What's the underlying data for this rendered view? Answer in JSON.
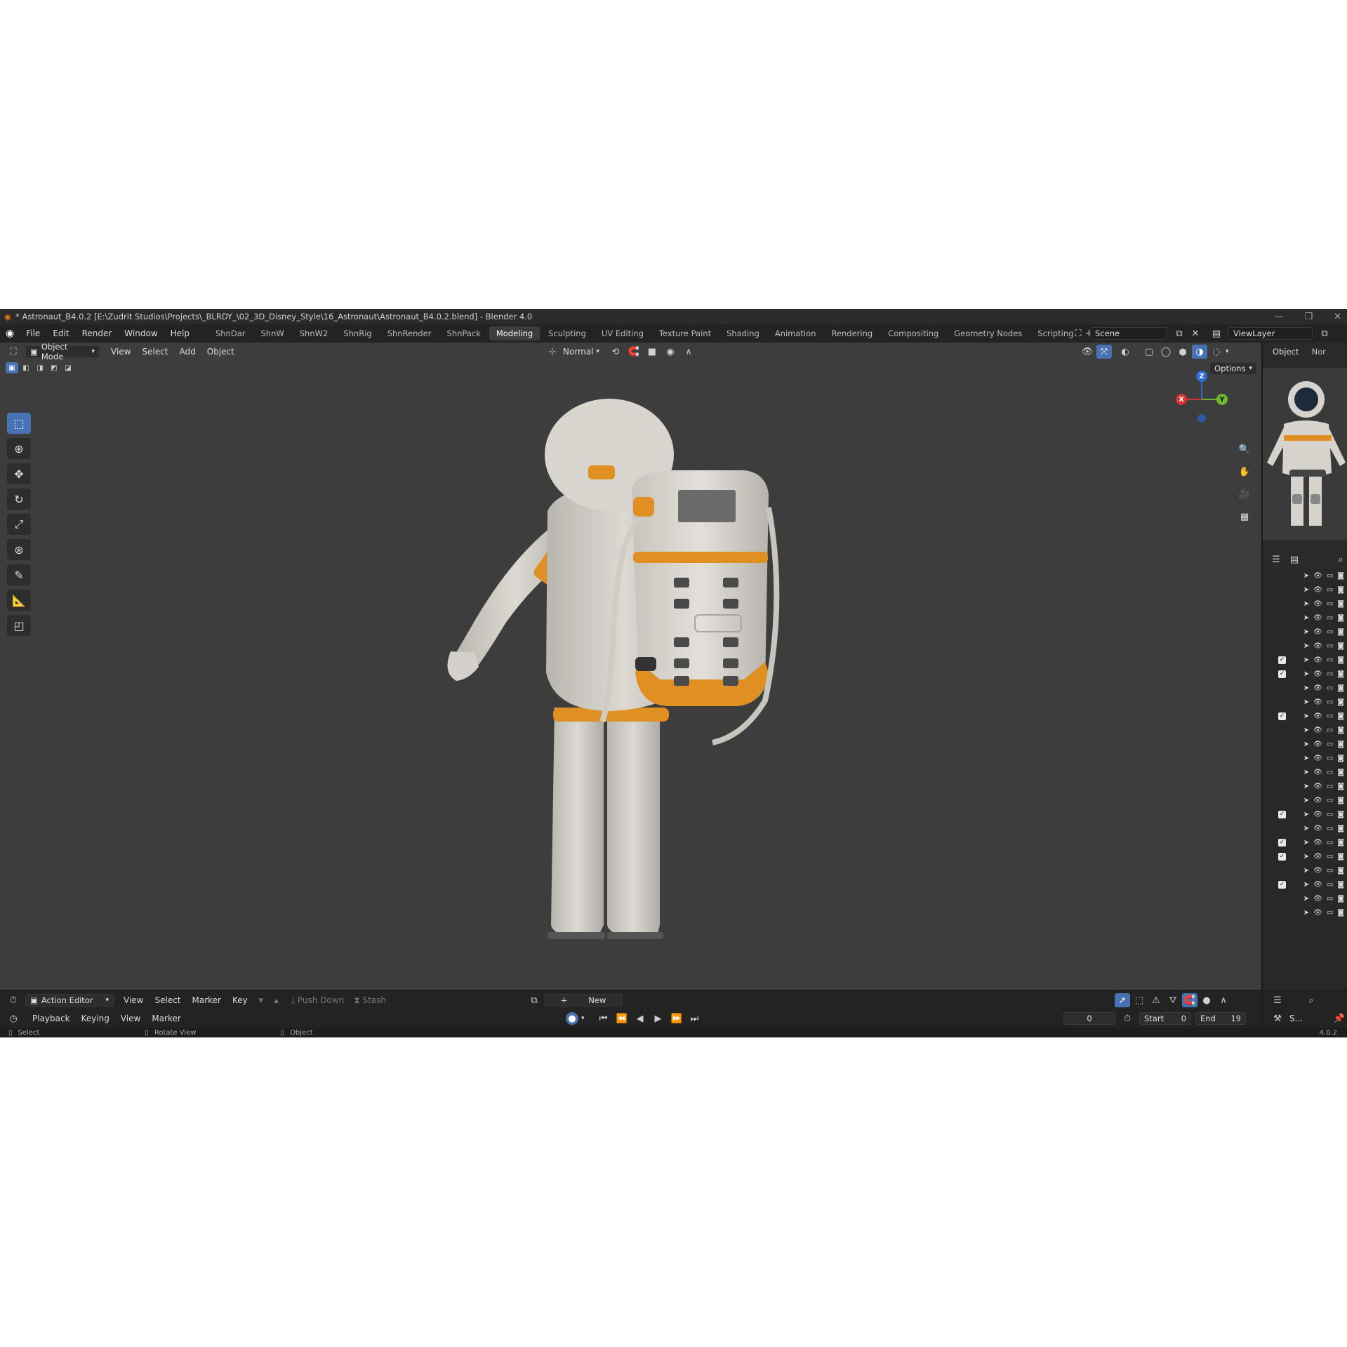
{
  "title_bar": {
    "text": "* Astronaut_B4.0.2 [E:\\Zudrit Studios\\Projects\\_BLRDY_\\02_3D_Disney_Style\\16_Astronaut\\Astronaut_B4.0.2.blend] - Blender 4.0"
  },
  "menu": [
    "File",
    "Edit",
    "Render",
    "Window",
    "Help"
  ],
  "workspaces": [
    "ShnDar",
    "ShnW",
    "ShnW2",
    "ShnRig",
    "ShnRender",
    "ShnPack",
    "Modeling",
    "Sculpting",
    "UV Editing",
    "Texture Paint",
    "Shading",
    "Animation",
    "Rendering",
    "Compositing",
    "Geometry Nodes",
    "Scripting"
  ],
  "active_workspace": "Modeling",
  "scene_name": "Scene",
  "view_layer": "ViewLayer",
  "viewport_header": {
    "mode": "Object Mode",
    "menus": [
      "View",
      "Select",
      "Add",
      "Object"
    ],
    "orientation": "Normal",
    "options": "Options"
  },
  "properties": {
    "tab_object": "Object",
    "tab_other": "Nor"
  },
  "gizmo": {
    "x": "X",
    "y": "Y",
    "z": "Z"
  },
  "outliner_rows": [
    {
      "checked": false
    },
    {
      "checked": false
    },
    {
      "checked": false
    },
    {
      "checked": false
    },
    {
      "checked": false
    },
    {
      "checked": false
    },
    {
      "checked": true
    },
    {
      "checked": true
    },
    {
      "checked": false
    },
    {
      "checked": false
    },
    {
      "checked": true
    },
    {
      "checked": false
    },
    {
      "checked": false
    },
    {
      "checked": false
    },
    {
      "checked": false
    },
    {
      "checked": false
    },
    {
      "checked": false
    },
    {
      "checked": true
    },
    {
      "checked": false
    },
    {
      "checked": true
    },
    {
      "checked": true
    },
    {
      "checked": false
    },
    {
      "checked": true
    },
    {
      "checked": false
    },
    {
      "checked": false
    }
  ],
  "action_editor": {
    "editor": "Action Editor",
    "menus": [
      "View",
      "Select",
      "Marker",
      "Key"
    ],
    "push_down": "Push Down",
    "stash": "Stash",
    "new": "New"
  },
  "timeline": {
    "menus": [
      "Playback",
      "Keying",
      "View",
      "Marker"
    ],
    "current_frame": "0",
    "start_label": "Start",
    "start": "0",
    "end_label": "End",
    "end": "19",
    "side_label": "S..."
  },
  "status_bar": {
    "select": "Select",
    "rotate_view": "Rotate View",
    "object": "Object",
    "version": "4.0.2"
  },
  "colors": {
    "accent": "#4772b3",
    "suit": "#d9d6d0",
    "trim": "#e08f22"
  }
}
